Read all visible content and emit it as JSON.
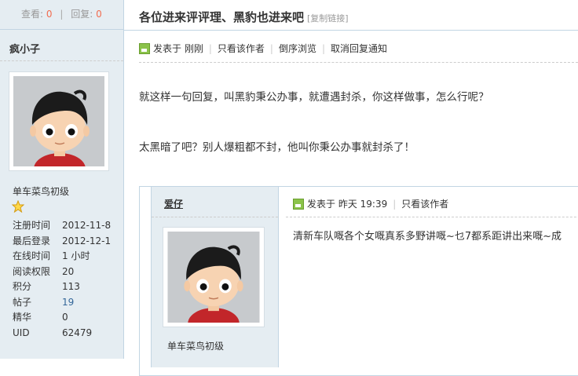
{
  "sidebar": {
    "views_label": "查看:",
    "views_value": "0",
    "sep": "|",
    "replies_label": "回复:",
    "replies_value": "0",
    "author": "疯小子",
    "rank": "单车菜鸟初级",
    "info": [
      {
        "k": "注册时间",
        "v": "2012-11-8"
      },
      {
        "k": "最后登录",
        "v": "2012-12-1"
      },
      {
        "k": "在线时间",
        "v": "1 小时"
      },
      {
        "k": "阅读权限",
        "v": "20"
      },
      {
        "k": "积分",
        "v": "113"
      },
      {
        "k": "帖子",
        "v": "19"
      },
      {
        "k": "精华",
        "v": "0"
      },
      {
        "k": "UID",
        "v": "62479"
      }
    ]
  },
  "thread": {
    "title": "各位进来评评理、黑豹也进来吧",
    "copy_link": "[复制链接]"
  },
  "post": {
    "posted_label": "发表于",
    "posted_time": "刚刚",
    "only_author": "只看该作者",
    "reverse": "倒序浏览",
    "cancel_notify": "取消回复通知",
    "lines": [
      "就这样一句回复，叫黑豹秉公办事，就遭遇封杀，你这样做事，怎么行呢？",
      "太黑暗了吧？别人爆粗都不封，他叫你秉公办事就封杀了！"
    ]
  },
  "quote": {
    "author": "爱仔",
    "rank": "单车菜鸟初级",
    "posted_label": "发表于",
    "posted_time": "昨天 19:39",
    "only_author": "只看该作者",
    "content": "清新车队嘅各个女嘅真系多野讲嘅~乜7都系距讲出来嘅~成"
  },
  "colors": {
    "sidebar_bg": "#e5edf2",
    "border": "#c2d5e3",
    "count_accent": "#f26c4f",
    "link": "#336699"
  }
}
